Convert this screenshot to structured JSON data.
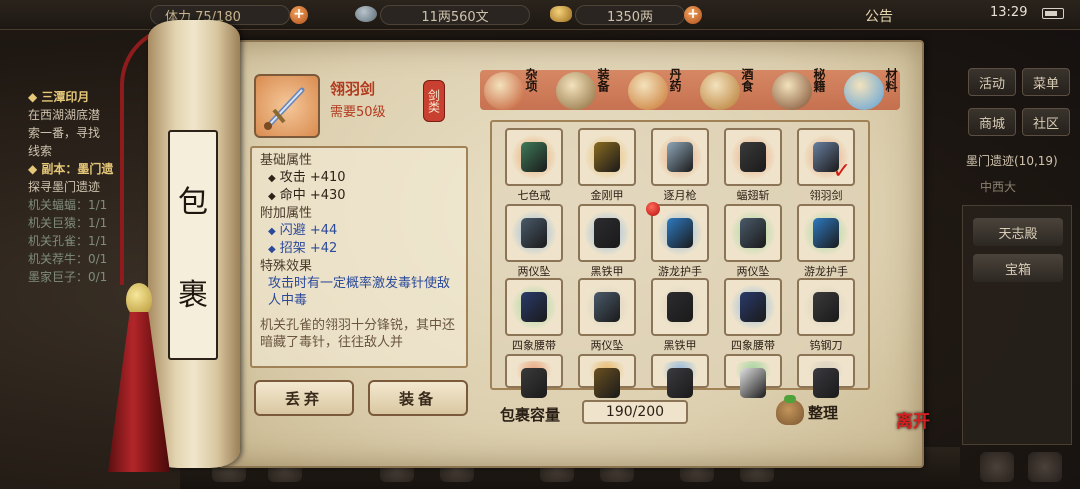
{
  "topbar": {
    "resource_left": "体力 75/180",
    "silver": "11两560文",
    "gold": "1350两",
    "notice": "公告",
    "time": "13:29"
  },
  "quest": {
    "title1": "◆ 三潭印月",
    "text1": "在西湖湖底潜",
    "text2": "索一番，寻找",
    "text3": "线索",
    "title2": "◆ 副本：墨门遗",
    "text4": "探寻墨门遗迹",
    "subs": [
      "机关蝠蝠：1/1",
      "机关巨猿：1/1",
      "机关孔雀：1/1",
      "机关荐牛：0/1",
      "墨家巨子：0/1"
    ]
  },
  "right_menu": {
    "activity": "活动",
    "menu": "菜单",
    "shop": "商城",
    "community": "社区",
    "dungeon": "墨门遗迹(10,19)",
    "east": "中西大",
    "item1": "天志殿",
    "item2": "宝箱"
  },
  "panel": {
    "title_chars": [
      "包",
      "裹"
    ],
    "item": {
      "name": "翎羽剑",
      "level": "需要50级",
      "category": "剑类"
    },
    "base_title": "基础属性",
    "base_stats": [
      {
        "label": "攻击",
        "value": "+410"
      },
      {
        "label": "命中",
        "value": "+430"
      }
    ],
    "bonus_title": "附加属性",
    "bonus_stats": [
      {
        "label": "闪避",
        "value": "+44"
      },
      {
        "label": "招架",
        "value": "+42"
      }
    ],
    "effect_title": "特殊效果",
    "effect_text": "攻击时有一定概率激发毒针使敌人中毒",
    "description": "机关孔雀的翎羽十分锋锐，其中还暗藏了毒针，往往敌人并",
    "discard_btn": "丢弃",
    "equip_btn": "装备",
    "tabs": [
      {
        "label": "杂项",
        "icon": "pot-icon"
      },
      {
        "label": "装备",
        "icon": "scroll-weapon-icon"
      },
      {
        "label": "丹药",
        "icon": "pill-icon"
      },
      {
        "label": "酒食",
        "icon": "wine-icon"
      },
      {
        "label": "秘籍",
        "icon": "book-icon"
      },
      {
        "label": "材料",
        "icon": "crystal-icon"
      }
    ],
    "grid": [
      {
        "name": "七色戒",
        "icon": "ring-icon",
        "glow": "#e7a26a",
        "color": "#3f7a5a"
      },
      {
        "name": "金刚甲",
        "icon": "armor-gold-icon",
        "glow": "#e7b86a",
        "color": "#8a6a20"
      },
      {
        "name": "逐月枪",
        "icon": "spear-icon",
        "glow": "#eaa27a",
        "color": "#8fa7b8"
      },
      {
        "name": "蝠翅斩",
        "icon": "bat-blade-icon",
        "glow": "#eaa27a",
        "color": "#3a3a3a"
      },
      {
        "name": "翎羽剑",
        "icon": "sword-icon",
        "glow": "#eaa27a",
        "color": "#6a7fa0",
        "selected": true
      },
      {
        "name": "两仪坠",
        "icon": "pendant-icon",
        "glow": "#8fb7de",
        "color": "#4a5a6a"
      },
      {
        "name": "黑铁甲",
        "icon": "armor-black-icon",
        "glow": "#8fb7de",
        "color": "#2c2c30"
      },
      {
        "name": "游龙护手",
        "icon": "gauntlet-icon",
        "glow": "#8fb7de",
        "color": "#2e7ac0"
      },
      {
        "name": "两仪坠",
        "icon": "pendant-icon",
        "glow": "#9ed49a",
        "color": "#4a5a6a"
      },
      {
        "name": "游龙护手",
        "icon": "gauntlet-icon",
        "glow": "#9ed49a",
        "color": "#2e7ac0"
      },
      {
        "name": "四象腰带",
        "icon": "belt-icon",
        "glow": "#9ed49a",
        "color": "#2a3a6a"
      },
      {
        "name": "两仪坠",
        "icon": "pendant-icon",
        "glow": "#d8d0c0",
        "color": "#4a5a6a"
      },
      {
        "name": "黑铁甲",
        "icon": "armor-black-icon",
        "glow": "#d8d0c0",
        "color": "#2c2c30"
      },
      {
        "name": "四象腰带",
        "icon": "belt-icon",
        "glow": "#8fb7de",
        "color": "#2a3a6a"
      },
      {
        "name": "钨钢刀",
        "icon": "blade-icon",
        "glow": "#d8d0c0",
        "color": "#3a3a3a"
      },
      {
        "name": "",
        "icon": "claw-icon",
        "glow": "#eaa27a",
        "color": "#3a3a3a"
      },
      {
        "name": "",
        "icon": "dagger-icon",
        "glow": "#e7b86a",
        "color": "#6a5020"
      },
      {
        "name": "",
        "icon": "helmet-icon",
        "glow": "#8fb7de",
        "color": "#3a3a40"
      },
      {
        "name": "",
        "icon": "pearl-icon",
        "glow": "#9ed49a",
        "color": "#e0e0e0"
      },
      {
        "name": "",
        "icon": "helmet-icon",
        "glow": "#d8d0c0",
        "color": "#3a3a40"
      }
    ],
    "capacity_label": "包裹容量",
    "capacity_value": "190/200",
    "sort_btn": "整理",
    "leave_btn": "离开"
  },
  "colors": {
    "accent_red": "#b23a1e",
    "stat_blue": "#2c4a9a",
    "parchment": "#e9dfc5"
  }
}
